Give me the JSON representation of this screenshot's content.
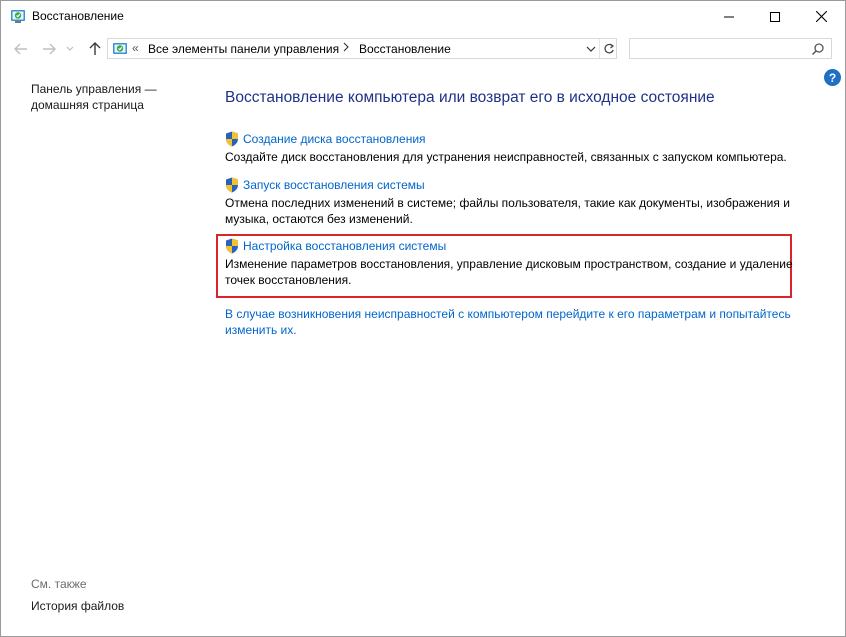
{
  "window": {
    "title": "Восстановление",
    "controls": [
      "minimize",
      "maximize",
      "close"
    ]
  },
  "navigation": {
    "breadcrumb_overflow": "«",
    "breadcrumb": [
      "Все элементы панели управления",
      "Восстановление"
    ],
    "search_placeholder": ""
  },
  "left_pane": {
    "home_link": "Панель управления — домашняя страница",
    "see_also_label": "См. также",
    "see_also_items": [
      "История файлов"
    ]
  },
  "help": {
    "label": "?"
  },
  "main": {
    "title": "Восстановление компьютера или возврат его в исходное состояние",
    "tasks": [
      {
        "link": "Создание диска восстановления",
        "description": "Создайте диск восстановления для устранения неисправностей, связанных с запуском компьютера."
      },
      {
        "link": "Запуск восстановления системы",
        "description": "Отмена последних изменений в системе; файлы пользователя, такие как документы, изображения и музыка, остаются без изменений."
      },
      {
        "link": "Настройка восстановления системы",
        "description": "Изменение параметров восстановления, управление дисковым пространством, создание и удаление точек восстановления."
      }
    ],
    "footer_link": "В случае возникновения неисправностей с компьютером перейдите к его параметрам и попытайтесь изменить их."
  },
  "colors": {
    "link": "#0066cc",
    "title": "#1e3287",
    "highlight_border": "#d9262c"
  }
}
